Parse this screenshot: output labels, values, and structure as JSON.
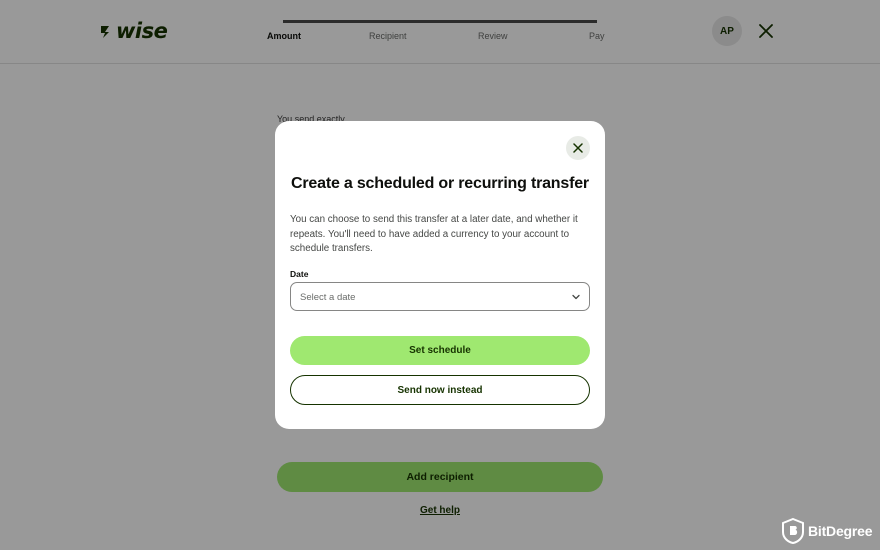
{
  "brand": {
    "name": "wise",
    "color": "#163300",
    "accent": "#9fe870"
  },
  "header": {
    "steps": [
      {
        "label": "Amount",
        "active": true
      },
      {
        "label": "Recipient",
        "active": false
      },
      {
        "label": "Review",
        "active": false
      },
      {
        "label": "Pay",
        "active": false
      }
    ],
    "avatar_initials": "AP",
    "close_icon": "close-icon"
  },
  "background": {
    "send_label": "You send exactly",
    "add_recipient_label": "Add recipient",
    "get_help_label": "Get help"
  },
  "modal": {
    "title": "Create a scheduled or recurring transfer",
    "description": "You can choose to send this transfer at a later date, and whether it repeats. You'll need to have added a currency to your account to schedule transfers.",
    "date_label": "Date",
    "date_placeholder": "Select a date",
    "set_schedule_label": "Set schedule",
    "send_now_label": "Send now instead"
  },
  "watermark": {
    "text": "BitDegree"
  }
}
